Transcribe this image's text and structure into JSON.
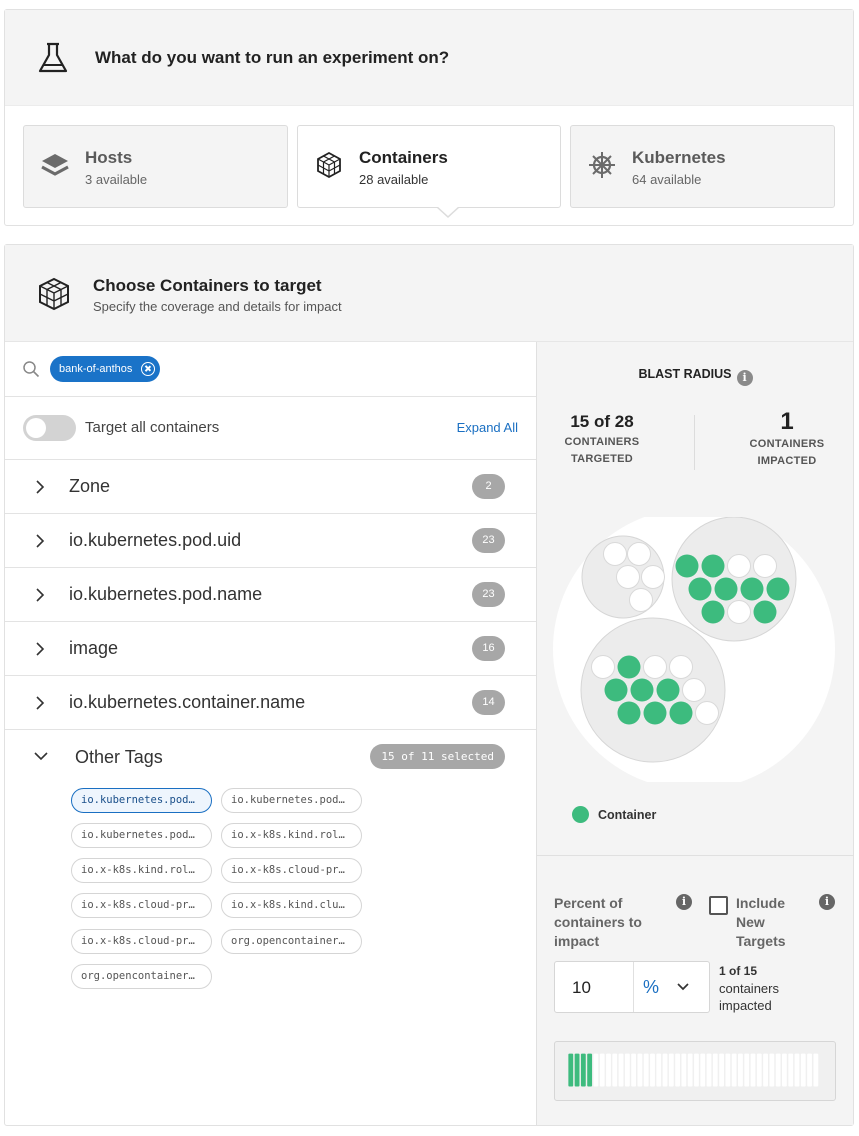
{
  "experiment": {
    "title": "What do you want to run an experiment on?",
    "types": [
      {
        "name": "Hosts",
        "available": "3 available",
        "icon": "layers-icon",
        "selected": false
      },
      {
        "name": "Containers",
        "available": "28 available",
        "icon": "cube-icon",
        "selected": true
      },
      {
        "name": "Kubernetes",
        "available": "64 available",
        "icon": "helm-wheel-icon",
        "selected": false
      }
    ]
  },
  "target": {
    "title": "Choose Containers to target",
    "subtitle": "Specify the coverage and details for impact",
    "search_chip": "bank-of-anthos",
    "target_all_label": "Target all containers",
    "expand_all": "Expand All",
    "groups": [
      {
        "label": "Zone",
        "count": "2"
      },
      {
        "label": "io.kubernetes.pod.uid",
        "count": "23"
      },
      {
        "label": "io.kubernetes.pod.name",
        "count": "23"
      },
      {
        "label": "image",
        "count": "16"
      },
      {
        "label": "io.kubernetes.container.name",
        "count": "14"
      }
    ],
    "other_tags": {
      "label": "Other Tags",
      "selected": "15 of 11 selected",
      "tags": [
        {
          "label": "io.kubernetes.pod…",
          "selected": true
        },
        {
          "label": "io.kubernetes.pod…",
          "selected": false
        },
        {
          "label": "io.kubernetes.pod…",
          "selected": false
        },
        {
          "label": "io.x-k8s.kind.rol…",
          "selected": false
        },
        {
          "label": "io.x-k8s.kind.rol…",
          "selected": false
        },
        {
          "label": "io.x-k8s.cloud-pr…",
          "selected": false
        },
        {
          "label": "io.x-k8s.cloud-pr…",
          "selected": false
        },
        {
          "label": "io.x-k8s.kind.clu…",
          "selected": false
        },
        {
          "label": "io.x-k8s.cloud-pr…",
          "selected": false
        },
        {
          "label": "org.opencontainer…",
          "selected": false
        },
        {
          "label": "org.opencontainer…",
          "selected": false
        }
      ]
    }
  },
  "blast": {
    "title": "BLAST RADIUS",
    "info": "i",
    "targeted_value": "15 of 28",
    "targeted_label_1": "CONTAINERS",
    "targeted_label_2": "TARGETED",
    "impacted_value": "1",
    "impacted_label_1": "CONTAINERS",
    "impacted_label_2": "IMPACTED",
    "legend": "Container",
    "accent": "#3dbb7e",
    "clusters": [
      {
        "targeted": 0,
        "total": 6
      },
      {
        "targeted": 9,
        "total": 12
      },
      {
        "targeted": 7,
        "total": 13
      }
    ]
  },
  "impact": {
    "percent_label": "Percent of containers to impact",
    "include_label": "Include New Targets",
    "include_checked": false,
    "value": "10",
    "unit": "%",
    "impacted_bold": "1 of 15",
    "impacted_text_1": "containers",
    "impacted_text_2": "impacted",
    "bar_total": 40,
    "bar_active": 4
  }
}
